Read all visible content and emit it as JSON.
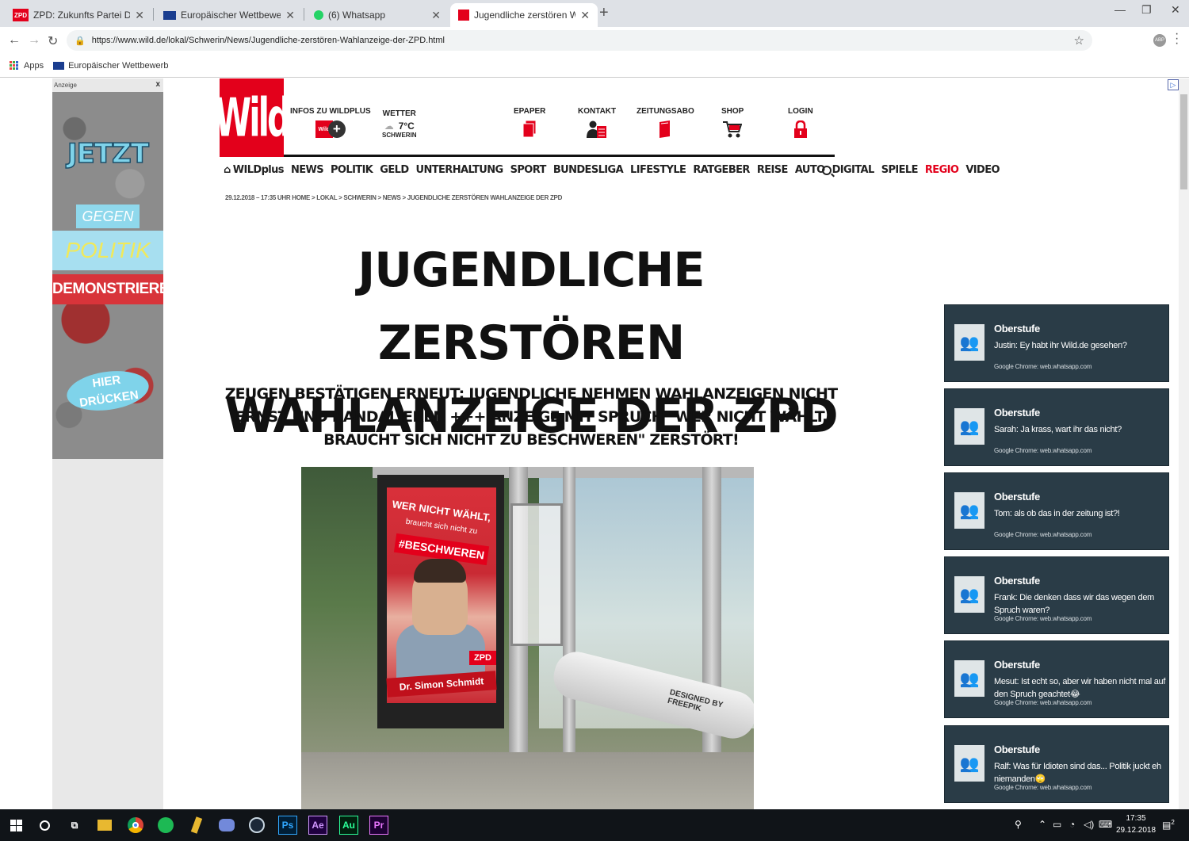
{
  "browser": {
    "tabs": [
      {
        "favicon": "ZPD",
        "title": "ZPD: Zukunfts Partei Deutschland"
      },
      {
        "favicon": "eu-flag",
        "title": "Europäischer Wettbewerb"
      },
      {
        "favicon": "whatsapp",
        "title": "(6) Whatsapp"
      },
      {
        "favicon": "wild",
        "title": "Jugendliche zerstören Wahlanzeige d"
      }
    ],
    "url": "https://www.wild.de/lokal/Schwerin/News/Jugendliche-zerstören-Wahlanzeige-der-ZPD.html",
    "bookmarks": {
      "apps": "Apps",
      "euro": "Europäischer Wettbewerb"
    }
  },
  "ad": {
    "label": "Anzeige",
    "close": "x",
    "jetzt": "JETZT",
    "gegen": "GEGEN",
    "politik": "POLITIK",
    "demo": "DEMONSTRIEREN",
    "hier": "HIER",
    "druecken": "DRÜCKEN"
  },
  "site": {
    "logo": "Wild",
    "header": {
      "wildplus": "INFOS ZU WILDPLUS",
      "wetter": "WETTER",
      "temp": "7°C",
      "city": "SCHWERIN",
      "epaper": "EPAPER",
      "kontakt": "KONTAKT",
      "abo": "ZEITUNGSABO",
      "shop": "SHOP",
      "login": "LOGIN"
    },
    "nav": [
      "WILDplus",
      "NEWS",
      "POLITIK",
      "GELD",
      "UNTERHALTUNG",
      "SPORT",
      "BUNDESLIGA",
      "LIFESTYLE",
      "RATGEBER",
      "REISE",
      "AUTO",
      "DIGITAL",
      "SPIELE",
      "REGIO",
      "VIDEO"
    ],
    "breadcrumb": "29.12.2018 – 17:35 UHR HOME > LOKAL > SCHWERIN > NEWS > JUGENDLICHE ZERSTÖREN WAHLANZEIGE DER ZPD"
  },
  "article": {
    "headline1": "JUGENDLICHE ZERSTÖREN",
    "headline2": "WAHLANZEIGE DER ZPD",
    "subline": "ZEUGEN BESTÄTIGEN ERNEUT: JUGENDLICHE NEHMEN WAHLANZEIGEN NICHT ERNST UND RANDALIEREN +++ ANZEIGE MIT SPRUCH \"WER NICHT WÄHLT, BRAUCHT SICH NICHT ZU BESCHWEREN\" ZERSTÖRT!",
    "photo": {
      "line1": "WER NICHT WÄHLT,",
      "line2": "braucht sich nicht zu",
      "line3": "#BESCHWEREN",
      "zpd": "ZPD",
      "name": "Dr. Simon Schmidt",
      "watermark": "DESIGNED BY FREEPIK"
    }
  },
  "notifications": [
    {
      "title": "Oberstufe",
      "message": "Justin: Ey habt ihr Wild.de gesehen?",
      "source": "Google Chrome: web.whatsapp.com"
    },
    {
      "title": "Oberstufe",
      "message": "Sarah: Ja krass, wart ihr das nicht?",
      "source": "Google Chrome: web.whatsapp.com"
    },
    {
      "title": "Oberstufe",
      "message": "Tom: als ob das in der zeitung ist?!",
      "source": "Google Chrome: web.whatsapp.com"
    },
    {
      "title": "Oberstufe",
      "message": "Frank: Die denken dass wir das wegen dem Spruch waren?",
      "source": "Google Chrome: web.whatsapp.com"
    },
    {
      "title": "Oberstufe",
      "message": "Mesut: Ist echt so, aber wir haben nicht mal auf den Spruch geachtet😂",
      "source": "Google Chrome: web.whatsapp.com"
    },
    {
      "title": "Oberstufe",
      "message": "Ralf: Was für Idioten sind das... Politik juckt eh niemanden🙄",
      "source": "Google Chrome: web.whatsapp.com"
    }
  ],
  "taskbar": {
    "time": "17:35",
    "date": "29.12.2018",
    "apps": [
      "Ps",
      "Ae",
      "Au",
      "Pr"
    ],
    "notif_count": "2"
  },
  "colors": {
    "brand_red": "#e3001b",
    "notif_bg": "#2a3c47",
    "taskbar": "#101418"
  }
}
